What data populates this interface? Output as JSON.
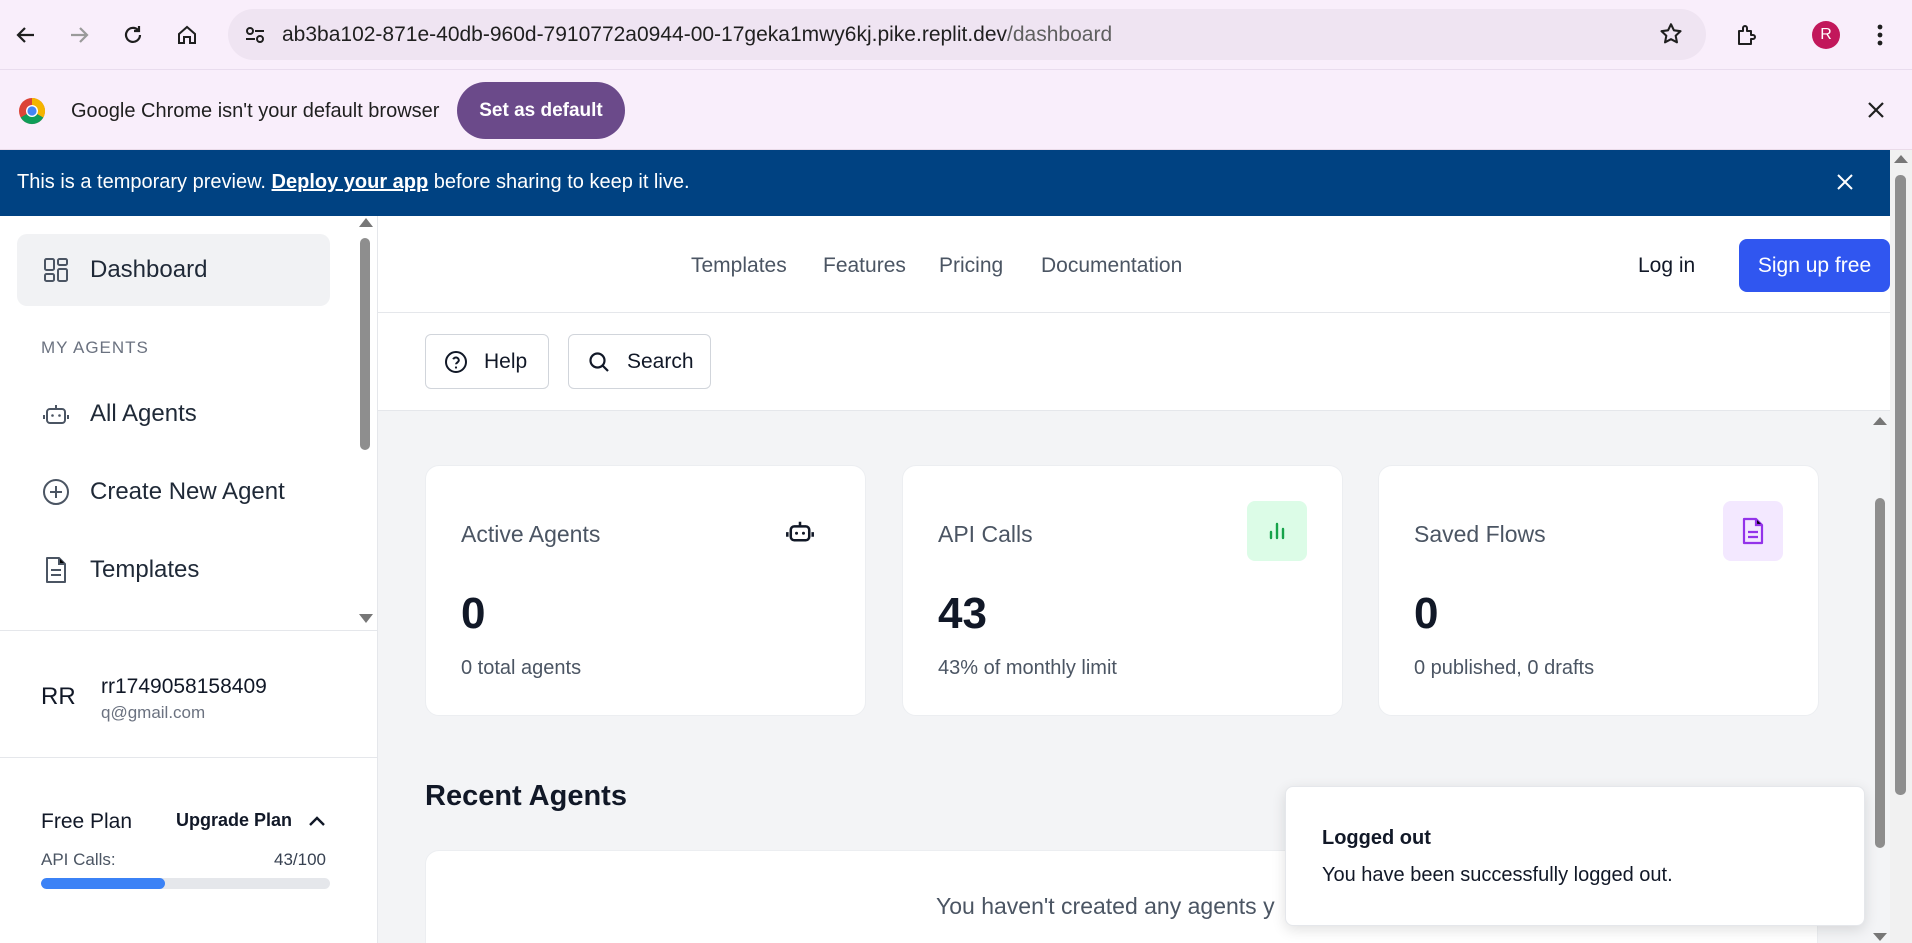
{
  "browser": {
    "url_host": "ab3ba102-871e-40db-960d-7910772a0944-00-17geka1mwy6kj.pike.replit.dev",
    "url_path": "/dashboard",
    "profile_initial": "R",
    "icons": [
      "back-icon",
      "forward-icon",
      "reload-icon",
      "home-icon",
      "site-info-icon",
      "star-icon",
      "extensions-icon",
      "menu-icon"
    ]
  },
  "infobar": {
    "message": "Google Chrome isn't your default browser",
    "button": "Set as default"
  },
  "preview_banner": {
    "before": "This is a temporary preview. ",
    "link": "Deploy your app",
    "after": " before sharing to keep it live."
  },
  "sidebar": {
    "dashboard": "Dashboard",
    "section": "MY AGENTS",
    "items": [
      "All Agents",
      "Create New Agent",
      "Templates"
    ],
    "user": {
      "initials": "RR",
      "name": "rr1749058158409",
      "email": "q@gmail.com"
    },
    "plan": {
      "name": "Free Plan",
      "upgrade": "Upgrade Plan",
      "api_label": "API Calls:",
      "api_value": "43/100",
      "api_fraction": 0.43,
      "bar_color": "#3b82f6"
    }
  },
  "topnav": {
    "links": [
      "Templates",
      "Features",
      "Pricing",
      "Documentation"
    ],
    "login": "Log in",
    "signup": "Sign up free",
    "signup_color": "#3056f0"
  },
  "toolbar": {
    "help": "Help",
    "search": "Search"
  },
  "stats": [
    {
      "title": "Active Agents",
      "value": "0",
      "sub": "0 total agents",
      "icon": "robot-icon"
    },
    {
      "title": "API Calls",
      "value": "43",
      "sub": "43% of monthly limit",
      "icon": "bar-chart-icon",
      "icon_bg": "#dcfce7",
      "icon_color": "#16a34a"
    },
    {
      "title": "Saved Flows",
      "value": "0",
      "sub": "0 published, 0 drafts",
      "icon": "document-icon",
      "icon_bg": "#f3e8ff",
      "icon_color": "#9333ea"
    }
  ],
  "recent": {
    "title": "Recent Agents",
    "empty_text": "You haven't created any agents y"
  },
  "toast": {
    "title": "Logged out",
    "description": "You have been successfully logged out."
  }
}
